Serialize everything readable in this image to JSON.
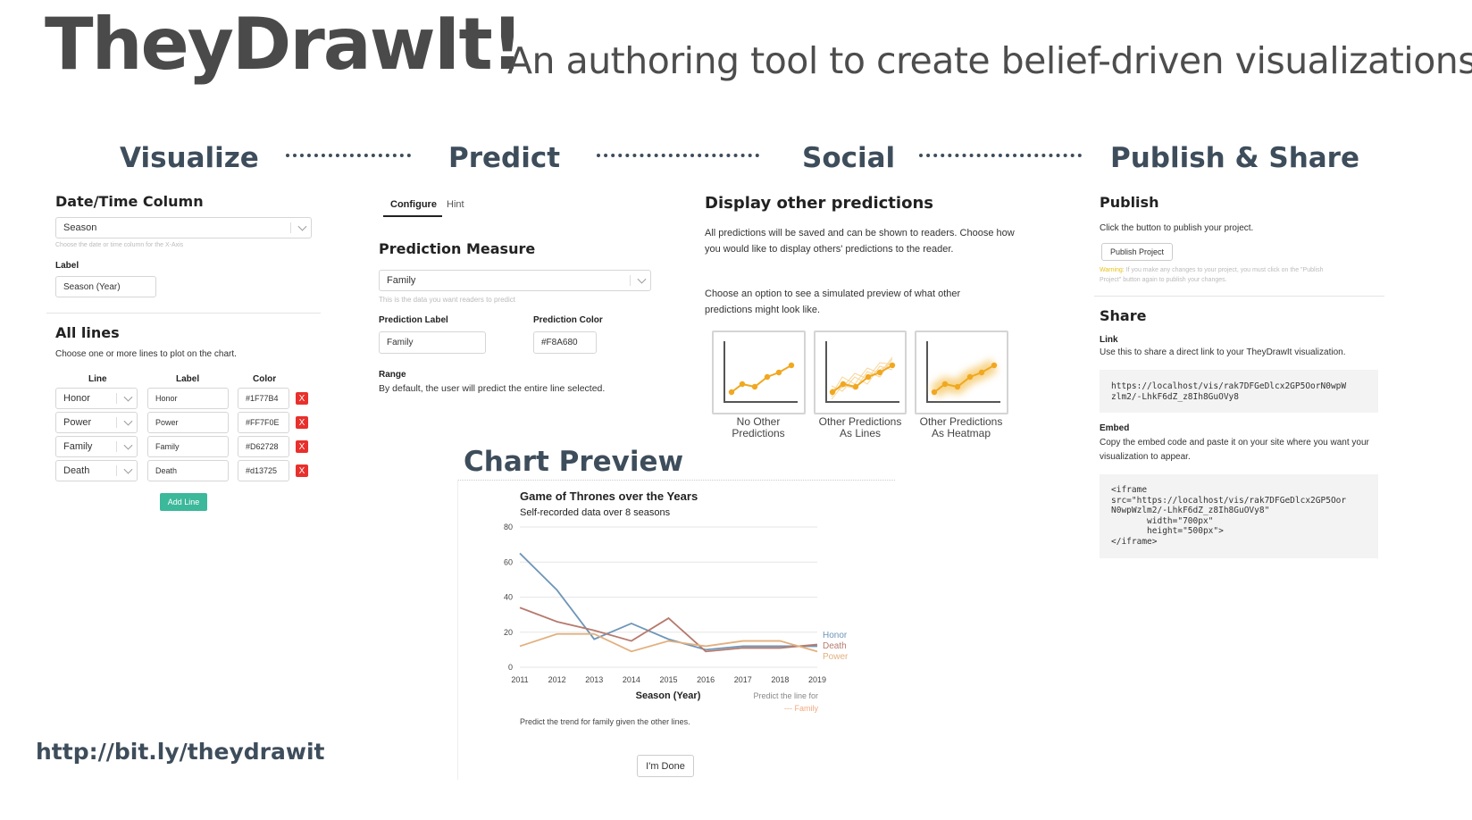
{
  "header": {
    "title": "TheyDrawIt!",
    "subtitle": "An authoring tool to create belief-driven visualizations"
  },
  "steps": [
    "Visualize",
    "Predict",
    "Social",
    "Publish & Share"
  ],
  "visualize": {
    "datetime_heading": "Date/Time Column",
    "datetime_value": "Season",
    "datetime_hint": "Choose the date or time column for the X-Axis",
    "label_heading": "Label",
    "label_value": "Season (Year)",
    "all_lines_heading": "All lines",
    "all_lines_desc": "Choose one or more lines to plot on the chart.",
    "columns": [
      "Line",
      "Label",
      "Color"
    ],
    "lines": [
      {
        "line": "Honor",
        "label": "Honor",
        "color": "#1F77B4",
        "remove": "X"
      },
      {
        "line": "Power",
        "label": "Power",
        "color": "#FF7F0E",
        "remove": "X"
      },
      {
        "line": "Family",
        "label": "Family",
        "color": "#D62728",
        "remove": "X"
      },
      {
        "line": "Death",
        "label": "Death",
        "color": "#d13725",
        "remove": "X"
      }
    ],
    "add_line": "Add Line"
  },
  "predict": {
    "tabs": [
      "Configure",
      "Hint"
    ],
    "active_tab": "Configure",
    "measure_heading": "Prediction Measure",
    "measure_value": "Family",
    "measure_hint": "This is the data you want readers to predict",
    "pred_label_heading": "Prediction Label",
    "pred_label_value": "Family",
    "pred_color_heading": "Prediction Color",
    "pred_color_value": "#F8A680",
    "range_heading": "Range",
    "range_desc": "By default, the user will predict the entire line selected."
  },
  "social": {
    "heading": "Display other predictions",
    "desc1": "All predictions will be saved and can be shown to readers. Choose how you would like to display others' predictions to the reader.",
    "desc2": "Choose an option to see a simulated preview of what other predictions might look like.",
    "options": [
      {
        "line1": "No Other",
        "line2": "Predictions"
      },
      {
        "line1": "Other Predictions",
        "line2": "As Lines"
      },
      {
        "line1": "Other Predictions",
        "line2": "As Heatmap"
      }
    ],
    "accent_color": "#f0a821"
  },
  "publish": {
    "publish_heading": "Publish",
    "publish_desc": "Click the button to publish your project.",
    "publish_button": "Publish Project",
    "warning_label": "Warning:",
    "warning_line1": "If you make any changes to your project, you must click on the \"Publish",
    "warning_line2": "Project\" button again to publish your changes.",
    "share_heading": "Share",
    "link_heading": "Link",
    "link_desc": "Use this to share a direct link to your TheyDrawIt visualization.",
    "link_code": "https://localhost/vis/rak7DFGeDlcx2GP5OorN0wpW\nzlm2/-LhkF6dZ_z8Ih8GuOVy8",
    "embed_heading": "Embed",
    "embed_desc": "Copy the embed code and paste it on your site where you want your visualization to appear.",
    "embed_code": "<iframe\nsrc=\"https://localhost/vis/rak7DFGeDlcx2GP5Oor\nN0wpWzlm2/-LhkF6dZ_z8Ih8GuOVy8\"\n       width=\"700px\"\n       height=\"500px\">\n</iframe>"
  },
  "preview": {
    "heading": "Chart Preview",
    "done_button": "I'm Done",
    "prompt": "Predict the trend for family given the other lines.",
    "legend_hint": "Predict the line for",
    "legend_series": "--- Family"
  },
  "chart_data": {
    "type": "line",
    "title": "Game of Thrones over the Years",
    "subtitle": "Self-recorded data over 8 seasons",
    "xlabel": "Season (Year)",
    "ylabel": "",
    "x": [
      2011,
      2012,
      2013,
      2014,
      2015,
      2016,
      2017,
      2018,
      2019
    ],
    "ylim": [
      0,
      80
    ],
    "yticks": [
      0,
      20,
      40,
      60,
      80
    ],
    "grid": true,
    "legend_position": "right",
    "series": [
      {
        "name": "Honor",
        "color": "#6e96b8",
        "values": [
          65,
          44,
          16,
          25,
          16,
          10,
          12,
          12,
          12
        ]
      },
      {
        "name": "Death",
        "color": "#b77a6e",
        "values": [
          34,
          26,
          21,
          15,
          28,
          9,
          11,
          11,
          13
        ]
      },
      {
        "name": "Power",
        "color": "#e2b07e",
        "values": [
          12,
          19,
          19,
          9,
          15,
          12,
          15,
          15,
          9
        ]
      }
    ]
  },
  "url": "http://bit.ly/theydrawit"
}
